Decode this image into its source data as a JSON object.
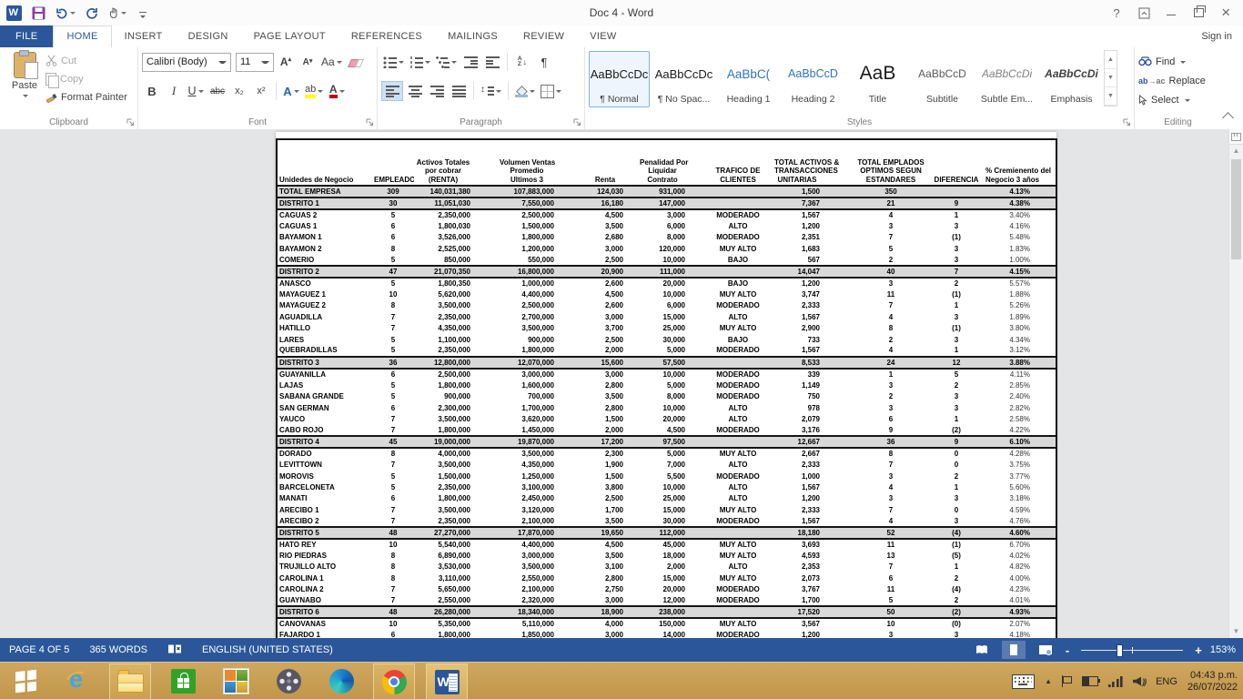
{
  "titlebar": {
    "title": "Doc 4 - Word",
    "help": "?",
    "sign_in": "Sign in"
  },
  "ribbon": {
    "tabs": [
      {
        "label": "FILE",
        "type": "file"
      },
      {
        "label": "HOME",
        "active": true
      },
      {
        "label": "INSERT"
      },
      {
        "label": "DESIGN"
      },
      {
        "label": "PAGE LAYOUT"
      },
      {
        "label": "REFERENCES"
      },
      {
        "label": "MAILINGS"
      },
      {
        "label": "REVIEW"
      },
      {
        "label": "VIEW"
      }
    ],
    "clipboard": {
      "label": "Clipboard",
      "paste": "Paste",
      "cut": "Cut",
      "copy": "Copy",
      "format_painter": "Format Painter"
    },
    "font": {
      "label": "Font",
      "name": "Calibri (Body)",
      "size": "11",
      "grow": "A",
      "shrink": "A",
      "case_label": "Aa",
      "bold": "B",
      "italic": "I",
      "underline": "U",
      "strike": "abc",
      "subscript": "x₂",
      "superscript": "x²",
      "effects": "A",
      "highlight": "ab",
      "color": "A"
    },
    "paragraph": {
      "label": "Paragraph",
      "sort_a": "A",
      "sort_z": "Z",
      "sort_arrow": "↓",
      "pilcrow": "¶"
    },
    "styles": {
      "label": "Styles",
      "items": [
        {
          "preview": "AaBbCcDc",
          "label": "¶ Normal",
          "cls": "st-normal",
          "selected": true
        },
        {
          "preview": "AaBbCcDc",
          "label": "¶ No Spac...",
          "cls": "st-normal"
        },
        {
          "preview": "AaBbC(",
          "label": "Heading 1",
          "cls": "st-h1"
        },
        {
          "preview": "AaBbCcD",
          "label": "Heading 2",
          "cls": "st-h2"
        },
        {
          "preview": "AaB",
          "label": "Title",
          "cls": "st-title"
        },
        {
          "preview": "AaBbCcD",
          "label": "Subtitle",
          "cls": "st-sub"
        },
        {
          "preview": "AaBbCcDi",
          "label": "Subtle Em...",
          "cls": "st-subtle"
        },
        {
          "preview": "AaBbCcDi",
          "label": "Emphasis",
          "cls": "st-emph"
        }
      ]
    },
    "editing": {
      "label": "Editing",
      "find": "Find",
      "replace": "Replace",
      "select": "Select"
    }
  },
  "document": {
    "table": {
      "headers": [
        "Unidedes de Negocio",
        "EMPLEADOS",
        "Activos Totales\npor cobrar\n(RENTA)",
        "Volumen Ventas\nPromedio\nUltimos 3",
        "Renta",
        "Penalidad Por\nLiquidar\nContrato",
        "TRAFICO DE\nCLIENTES",
        "TOTAL ACTIVOS &\nTRANSACCIONES\nUNITARIAS",
        "TOTAL EMPLADOS\nOPTIMOS SEGUN\nESTANDARES",
        "DIFERENCIA",
        "% Cremienento del\nNegocio 3 años"
      ],
      "rows": [
        {
          "t": "total",
          "c": [
            "TOTAL EMPRESA",
            "309",
            "140,031,380",
            "107,883,000",
            "124,030",
            "931,000",
            "",
            "1,500",
            "350",
            "",
            "4.13%"
          ]
        },
        {
          "t": "dist",
          "c": [
            "DISTRITO 1",
            "30",
            "11,051,030",
            "7,550,000",
            "16,180",
            "147,000",
            "",
            "7,367",
            "21",
            "9",
            "4.38%"
          ]
        },
        {
          "t": "unit",
          "c": [
            "CAGUAS 2",
            "5",
            "2,350,000",
            "2,500,000",
            "4,500",
            "3,000",
            "MODERADO",
            "1,567",
            "4",
            "1",
            "3.40%"
          ]
        },
        {
          "t": "unit",
          "c": [
            "CAGUAS 1",
            "6",
            "1,800,030",
            "1,500,000",
            "3,500",
            "6,000",
            "ALTO",
            "1,200",
            "3",
            "3",
            "4.16%"
          ]
        },
        {
          "t": "unit",
          "c": [
            "BAYAMON 1",
            "6",
            "3,526,000",
            "1,800,000",
            "2,680",
            "8,000",
            "MODERADO",
            "2,351",
            "7",
            "(1)",
            "5.48%"
          ]
        },
        {
          "t": "unit",
          "c": [
            "BAYAMON 2",
            "8",
            "2,525,000",
            "1,200,000",
            "3,000",
            "120,000",
            "MUY ALTO",
            "1,683",
            "5",
            "3",
            "1.83%"
          ]
        },
        {
          "t": "unit",
          "c": [
            "COMERIO",
            "5",
            "850,000",
            "550,000",
            "2,500",
            "10,000",
            "BAJO",
            "567",
            "2",
            "3",
            "1.00%"
          ]
        },
        {
          "t": "dist",
          "c": [
            "DISTRITO 2",
            "47",
            "21,070,350",
            "16,800,000",
            "20,900",
            "111,000",
            "",
            "14,047",
            "40",
            "7",
            "4.15%"
          ]
        },
        {
          "t": "unit",
          "c": [
            "ANASCO",
            "5",
            "1,800,350",
            "1,000,000",
            "2,600",
            "20,000",
            "BAJO",
            "1,200",
            "3",
            "2",
            "5.57%"
          ]
        },
        {
          "t": "unit",
          "c": [
            "MAYAGUEZ 1",
            "10",
            "5,620,000",
            "4,400,000",
            "4,500",
            "10,000",
            "MUY ALTO",
            "3,747",
            "11",
            "(1)",
            "1.88%"
          ]
        },
        {
          "t": "unit",
          "c": [
            "MAYAGUEZ 2",
            "8",
            "3,500,000",
            "2,500,000",
            "2,600",
            "6,000",
            "MODERADO",
            "2,333",
            "7",
            "1",
            "5.26%"
          ]
        },
        {
          "t": "unit",
          "c": [
            "AGUADILLA",
            "7",
            "2,350,000",
            "2,700,000",
            "3,000",
            "15,000",
            "ALTO",
            "1,567",
            "4",
            "3",
            "1.89%"
          ]
        },
        {
          "t": "unit",
          "c": [
            "HATILLO",
            "7",
            "4,350,000",
            "3,500,000",
            "3,700",
            "25,000",
            "MUY ALTO",
            "2,900",
            "8",
            "(1)",
            "3.80%"
          ]
        },
        {
          "t": "unit",
          "c": [
            "LARES",
            "5",
            "1,100,000",
            "900,000",
            "2,500",
            "30,000",
            "BAJO",
            "733",
            "2",
            "3",
            "4.34%"
          ]
        },
        {
          "t": "unit",
          "c": [
            "QUEBRADILLAS",
            "5",
            "2,350,000",
            "1,800,000",
            "2,000",
            "5,000",
            "MODERADO",
            "1,567",
            "4",
            "1",
            "3.12%"
          ]
        },
        {
          "t": "dist",
          "c": [
            "DISTRITO 3",
            "36",
            "12,800,000",
            "12,070,000",
            "15,600",
            "57,500",
            "",
            "8,533",
            "24",
            "12",
            "3.88%"
          ]
        },
        {
          "t": "unit",
          "c": [
            "GUAYANILLA",
            "6",
            "2,500,000",
            "3,000,000",
            "3,000",
            "10,000",
            "MODERADO",
            "339",
            "1",
            "5",
            "4.11%"
          ]
        },
        {
          "t": "unit",
          "c": [
            "LAJAS",
            "5",
            "1,800,000",
            "1,600,000",
            "2,800",
            "5,000",
            "MODERADO",
            "1,149",
            "3",
            "2",
            "2.85%"
          ]
        },
        {
          "t": "unit",
          "c": [
            "SABANA GRANDE",
            "5",
            "900,000",
            "700,000",
            "3,500",
            "8,000",
            "MODERADO",
            "750",
            "2",
            "3",
            "2.40%"
          ]
        },
        {
          "t": "unit",
          "c": [
            "SAN GERMAN",
            "6",
            "2,300,000",
            "1,700,000",
            "2,800",
            "10,000",
            "ALTO",
            "978",
            "3",
            "3",
            "2.82%"
          ]
        },
        {
          "t": "unit",
          "c": [
            "YAUCO",
            "7",
            "3,500,000",
            "3,620,000",
            "1,500",
            "20,000",
            "ALTO",
            "2,079",
            "6",
            "1",
            "2.58%"
          ]
        },
        {
          "t": "unit",
          "c": [
            "CABO ROJO",
            "7",
            "1,800,000",
            "1,450,000",
            "2,000",
            "4,500",
            "MODERADO",
            "3,176",
            "9",
            "(2)",
            "4.22%"
          ]
        },
        {
          "t": "dist",
          "c": [
            "DISTRITO 4",
            "45",
            "19,000,000",
            "19,870,000",
            "17,200",
            "97,500",
            "",
            "12,667",
            "36",
            "9",
            "6.10%"
          ]
        },
        {
          "t": "unit",
          "c": [
            "DORADO",
            "8",
            "4,000,000",
            "3,500,000",
            "2,300",
            "5,000",
            "MUY ALTO",
            "2,667",
            "8",
            "0",
            "4.28%"
          ]
        },
        {
          "t": "unit",
          "c": [
            "LEVITTOWN",
            "7",
            "3,500,000",
            "4,350,000",
            "1,900",
            "7,000",
            "ALTO",
            "2,333",
            "7",
            "0",
            "3.75%"
          ]
        },
        {
          "t": "unit",
          "c": [
            "MOROVIS",
            "5",
            "1,500,000",
            "1,250,000",
            "1,500",
            "5,500",
            "MODERADO",
            "1,000",
            "3",
            "2",
            "3.77%"
          ]
        },
        {
          "t": "unit",
          "c": [
            "BARCELONETA",
            "5",
            "2,350,000",
            "3,100,000",
            "3,800",
            "10,000",
            "ALTO",
            "1,567",
            "4",
            "1",
            "5.60%"
          ]
        },
        {
          "t": "unit",
          "c": [
            "MANATI",
            "6",
            "1,800,000",
            "2,450,000",
            "2,500",
            "25,000",
            "ALTO",
            "1,200",
            "3",
            "3",
            "3.18%"
          ]
        },
        {
          "t": "unit",
          "c": [
            "ARECIBO 1",
            "7",
            "3,500,000",
            "3,120,000",
            "1,700",
            "15,000",
            "MUY ALTO",
            "2,333",
            "7",
            "0",
            "4.59%"
          ]
        },
        {
          "t": "unit",
          "c": [
            "ARECIBO 2",
            "7",
            "2,350,000",
            "2,100,000",
            "3,500",
            "30,000",
            "MODERADO",
            "1,567",
            "4",
            "3",
            "4.76%"
          ]
        },
        {
          "t": "dist",
          "c": [
            "DISTRITO 5",
            "48",
            "27,270,000",
            "17,870,000",
            "19,650",
            "112,000",
            "",
            "18,180",
            "52",
            "(4)",
            "4.60%"
          ]
        },
        {
          "t": "unit",
          "c": [
            "HATO REY",
            "10",
            "5,540,000",
            "4,400,000",
            "4,500",
            "45,000",
            "MUY ALTO",
            "3,693",
            "11",
            "(1)",
            "6.70%"
          ]
        },
        {
          "t": "unit",
          "c": [
            "RIO PIEDRAS",
            "8",
            "6,890,000",
            "3,000,000",
            "3,500",
            "18,000",
            "MUY ALTO",
            "4,593",
            "13",
            "(5)",
            "4.02%"
          ]
        },
        {
          "t": "unit",
          "c": [
            "TRUJILLO ALTO",
            "8",
            "3,530,000",
            "3,500,000",
            "3,100",
            "2,000",
            "ALTO",
            "2,353",
            "7",
            "1",
            "4.82%"
          ]
        },
        {
          "t": "unit",
          "c": [
            "CAROLINA 1",
            "8",
            "3,110,000",
            "2,550,000",
            "2,800",
            "15,000",
            "MUY ALTO",
            "2,073",
            "6",
            "2",
            "4.00%"
          ]
        },
        {
          "t": "unit",
          "c": [
            "CAROLINA 2",
            "7",
            "5,650,000",
            "2,100,000",
            "2,750",
            "20,000",
            "MODERADO",
            "3,767",
            "11",
            "(4)",
            "4.23%"
          ]
        },
        {
          "t": "unit",
          "c": [
            "GUAYNABO",
            "7",
            "2,550,000",
            "2,320,000",
            "3,000",
            "12,000",
            "MODERADO",
            "1,700",
            "5",
            "2",
            "4.01%"
          ]
        },
        {
          "t": "dist",
          "c": [
            "DISTRITO 6",
            "48",
            "26,280,000",
            "18,340,000",
            "18,900",
            "238,000",
            "",
            "17,520",
            "50",
            "(2)",
            "4.93%"
          ]
        },
        {
          "t": "unit",
          "c": [
            "CANOVANAS",
            "10",
            "5,350,000",
            "5,110,000",
            "4,000",
            "150,000",
            "MUY ALTO",
            "3,567",
            "10",
            "(0)",
            "2.07%"
          ]
        },
        {
          "t": "unit",
          "c": [
            "FAJARDO 1",
            "6",
            "1,800,000",
            "1,850,000",
            "3,000",
            "14,000",
            "MODERADO",
            "1,200",
            "3",
            "3",
            "4.18%"
          ]
        }
      ]
    }
  },
  "status_bar": {
    "page": "PAGE 4 OF 5",
    "words": "365 WORDS",
    "language": "ENGLISH (UNITED STATES)",
    "zoom_out": "-",
    "zoom_in": "+",
    "zoom_level": "153%"
  },
  "taskbar": {
    "apps": [
      {
        "name": "start"
      },
      {
        "name": "internet-explorer"
      },
      {
        "name": "file-explorer",
        "open": true
      },
      {
        "name": "store"
      },
      {
        "name": "photos"
      },
      {
        "name": "movie-maker"
      },
      {
        "name": "edge"
      },
      {
        "name": "chrome",
        "open": true
      },
      {
        "name": "word",
        "open": true,
        "active": true
      }
    ],
    "tray": {
      "language": "ENG",
      "time": "04:43 p.m.",
      "date": "26/07/2022"
    }
  },
  "colors": {
    "accent": "#2b579a",
    "status_bar": "#2b579a",
    "file_tab": "#2b579a",
    "taskbar": "#c79e54",
    "district_row": "#d9d9d9",
    "page": "#ffffff"
  }
}
